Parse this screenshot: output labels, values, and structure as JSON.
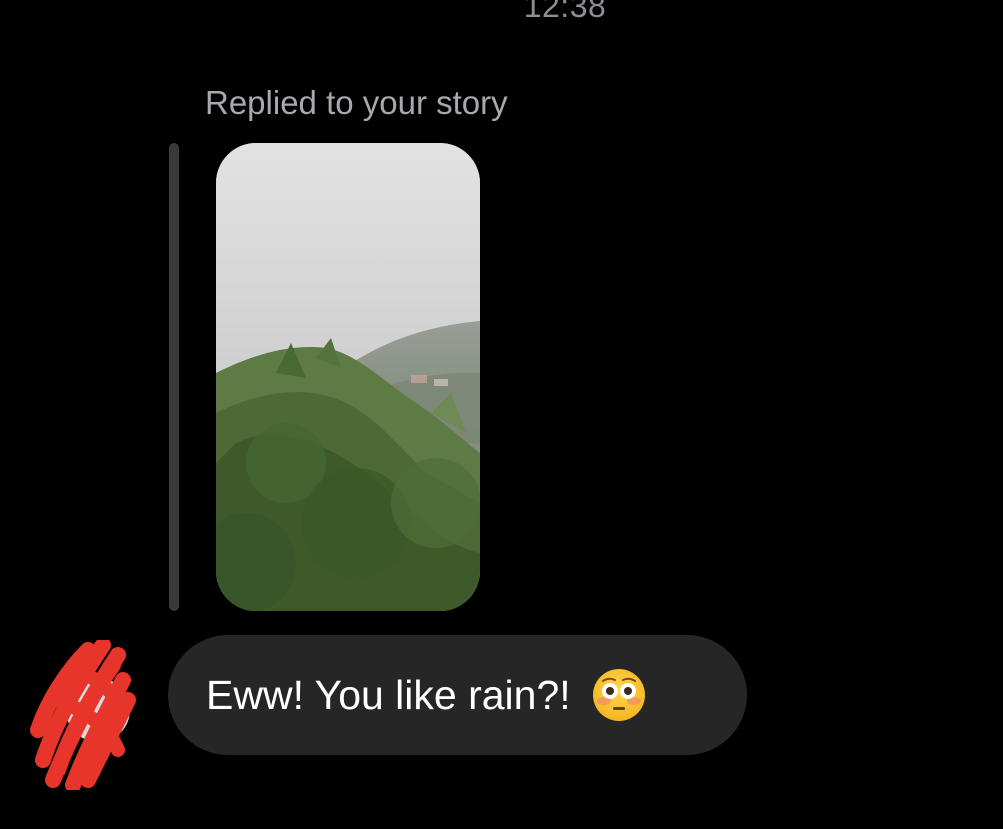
{
  "header": {
    "time": "12:38"
  },
  "story_reply": {
    "label": "Replied to your story",
    "story_caption": ":)"
  },
  "message": {
    "text": "Eww! You like rain?!",
    "emoji_icon": "flushed-face-emoji"
  },
  "colors": {
    "background": "#000000",
    "bubble": "#262626",
    "reply_bar": "#3a3a3c",
    "redaction": "#e8352b"
  }
}
